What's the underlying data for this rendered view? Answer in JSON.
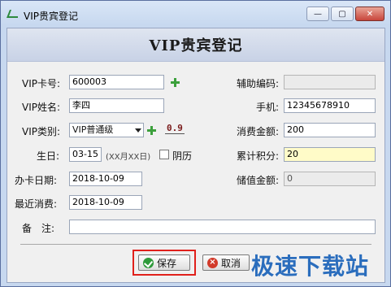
{
  "window": {
    "title": "VIP贵宾登记"
  },
  "controls": {
    "minimize": "—",
    "maximize": "▢",
    "close": "✕"
  },
  "header": {
    "title": "VIP贵宾登记"
  },
  "form": {
    "card_no": {
      "label": "VIP卡号:",
      "value": "600003"
    },
    "name": {
      "label": "VIP姓名:",
      "value": "李四"
    },
    "type": {
      "label": "VIP类别:",
      "value": "VIP普通级",
      "discount": "0.9"
    },
    "birthday": {
      "label": "生日:",
      "value": "03-15",
      "hint": "(XX月XX日)",
      "lunar_label": "阴历"
    },
    "card_date": {
      "label": "办卡日期:",
      "value": "2018-10-09"
    },
    "last_spend": {
      "label": "最近消费:",
      "value": "2018-10-09"
    },
    "note": {
      "label": "备　注:",
      "value": ""
    },
    "aux_code": {
      "label": "辅助编码:",
      "value": ""
    },
    "phone": {
      "label": "手机:",
      "value": "12345678910"
    },
    "spend_amount": {
      "label": "消费金额:",
      "value": "200"
    },
    "points": {
      "label": "累计积分:",
      "value": "20"
    },
    "stored_value": {
      "label": "储值金额:",
      "value": "0"
    }
  },
  "buttons": {
    "save": "保存",
    "cancel": "取消"
  },
  "watermark": "极速下载站"
}
